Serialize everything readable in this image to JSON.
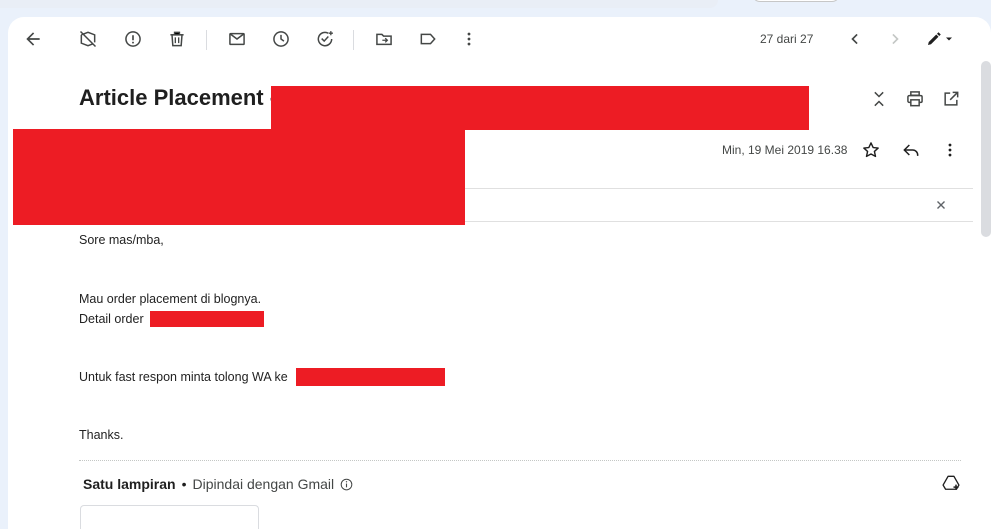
{
  "toolbar": {
    "back": "arrow-back-icon",
    "pager_text": "27 dari 27"
  },
  "email": {
    "subject": "Article Placement -",
    "date": "Min, 19 Mei 2019 16.38",
    "body": {
      "greeting": "Sore mas/mba,",
      "line1": "Mau order placement di blognya.",
      "line2": "Detail order",
      "line3": "Untuk fast respon minta tolong WA ke",
      "closing": "Thanks."
    }
  },
  "attachments": {
    "title": "Satu lampiran",
    "separator": "•",
    "scan_text": "Dipindai dengan Gmail"
  },
  "colors": {
    "redaction": "#ed1c24",
    "background": "#eaf1fb",
    "panel": "#ffffff",
    "icon": "#444746"
  }
}
